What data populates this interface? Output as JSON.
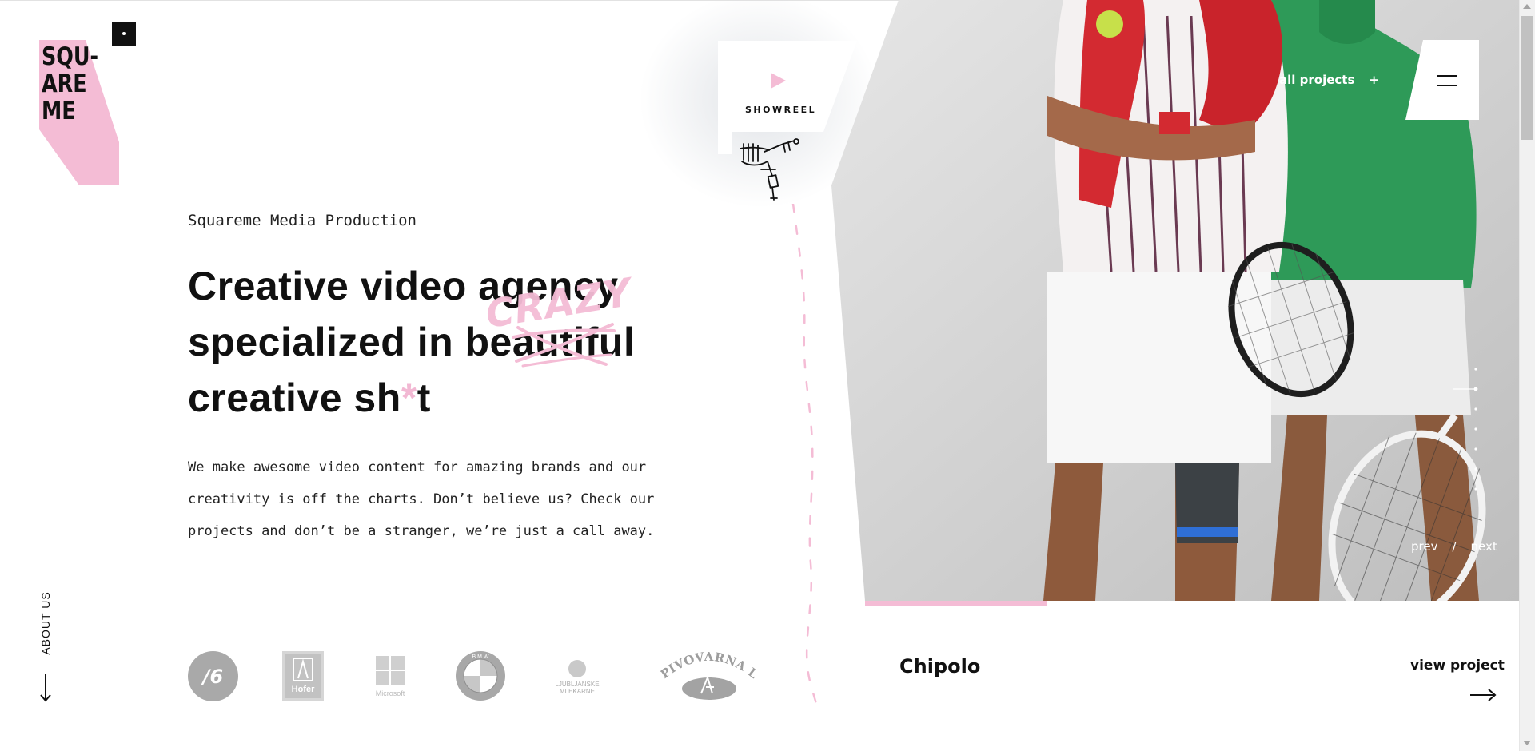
{
  "logo": {
    "lines": [
      "SQU-",
      "ARE",
      "ME"
    ],
    "brand_color": "#f4bcd5"
  },
  "nav": {
    "about_us": "ABOUT US",
    "all_projects": "all projects",
    "all_projects_icon": "+",
    "menu_icon": "hamburger-menu-icon"
  },
  "hero": {
    "subtitle": "Squareme Media Production",
    "headline": {
      "line1": "Creative video agency",
      "line2_prefix": "specialized in be",
      "line2_struck": "auti",
      "line2_suffix": "ful",
      "line3_prefix": "creative sh",
      "line3_star": "*",
      "line3_suffix": "t",
      "overlay_word": "CRAZY"
    },
    "description": "We make awesome video content for amazing brands and our creativity is off the charts. Don’t believe us? Check our projects and don’t be a stranger, we’re just a call away."
  },
  "showreel": {
    "label": "SHOWREEL",
    "icon": "play-icon"
  },
  "brands": {
    "items": [
      {
        "name": "nlb",
        "text": "/6"
      },
      {
        "name": "hofer",
        "text": "Hofer"
      },
      {
        "name": "microsoft",
        "text": "Microsoft"
      },
      {
        "name": "bmw",
        "text": "B M W"
      },
      {
        "name": "ljubljanske-mlekarne",
        "line1": "LJUBLJANSKE",
        "line2": "MLEKARNE"
      },
      {
        "name": "pivovarna-lasko",
        "text": "PIVOVARNA LAŠKO"
      }
    ]
  },
  "slider": {
    "prev": "prev",
    "separator": "/",
    "next": "next",
    "total_slides": 7,
    "active_index": 1
  },
  "project": {
    "title": "Chipolo",
    "view_label": "view project"
  },
  "colors": {
    "accent_pink": "#f4bcd5",
    "text_dark": "#111111"
  }
}
